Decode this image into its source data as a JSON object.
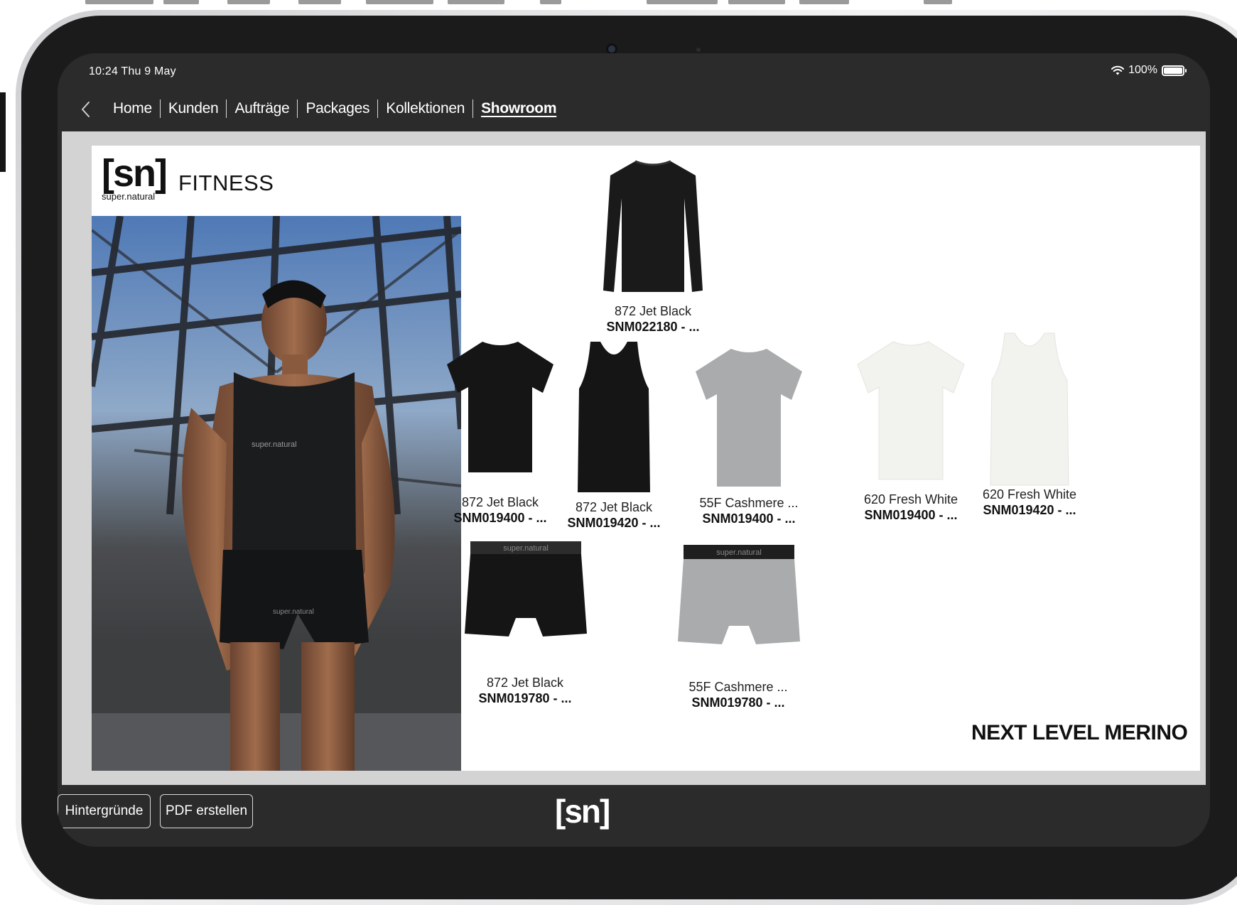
{
  "status": {
    "time": "10:24  Thu 9 May",
    "battery": "100%"
  },
  "nav": {
    "items": [
      {
        "label": "Home"
      },
      {
        "label": "Kunden"
      },
      {
        "label": "Aufträge"
      },
      {
        "label": "Packages"
      },
      {
        "label": "Kollektionen"
      },
      {
        "label": "Showroom"
      }
    ],
    "active": "Showroom"
  },
  "brand": {
    "logo": "[sn]",
    "sub": "super.natural",
    "category": "FITNESS"
  },
  "products": [
    {
      "color": "872 Jet Black",
      "sku": "SNM022180 - ..."
    },
    {
      "color": "872 Jet Black",
      "sku": "SNM019400 - ..."
    },
    {
      "color": "872 Jet Black",
      "sku": "SNM019420 - ..."
    },
    {
      "color": "55F Cashmere ...",
      "sku": "SNM019400 - ..."
    },
    {
      "color": "620 Fresh White",
      "sku": "SNM019400 - ..."
    },
    {
      "color": "620 Fresh White",
      "sku": "SNM019420 - ..."
    },
    {
      "color": "872 Jet Black",
      "sku": "SNM019780 - ..."
    },
    {
      "color": "55F Cashmere ...",
      "sku": "SNM019780 - ..."
    }
  ],
  "tagline": "NEXT LEVEL MERINO",
  "footer": {
    "backgrounds_button": "Hintergründe",
    "pdf_button": "PDF erstellen",
    "logo": "[sn]"
  },
  "colors": {
    "screen_bg": "#2b2b2c",
    "jet_black": "#151515",
    "cashmere": "#a9abad",
    "fresh_white": "#f2f2ee"
  }
}
